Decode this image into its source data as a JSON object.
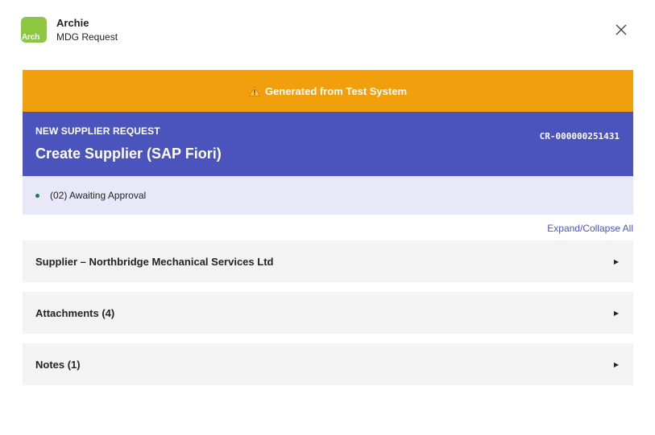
{
  "header": {
    "avatar_text": "Arch",
    "app_name": "Archie",
    "app_subtitle": "MDG Request",
    "avatar_color": "#8dc63f"
  },
  "banner": {
    "icon": "warning-icon",
    "text": "Generated from Test System",
    "color": "#f29f0e"
  },
  "request": {
    "eyebrow": "NEW SUPPLIER REQUEST",
    "title": "Create Supplier (SAP Fiori)",
    "cr_number": "CR-000000251431",
    "color": "#4b53bc"
  },
  "status": {
    "text": "(02) Awaiting Approval",
    "dot_color": "#237b4b"
  },
  "expand_collapse_label": "Expand/Collapse All",
  "sections": [
    {
      "label": "Supplier – Northbridge Mechanical Services Ltd",
      "icon": "caret-right-icon"
    },
    {
      "label": "Attachments (4)",
      "icon": "caret-right-icon"
    },
    {
      "label": "Notes (1)",
      "icon": "caret-right-icon"
    }
  ]
}
